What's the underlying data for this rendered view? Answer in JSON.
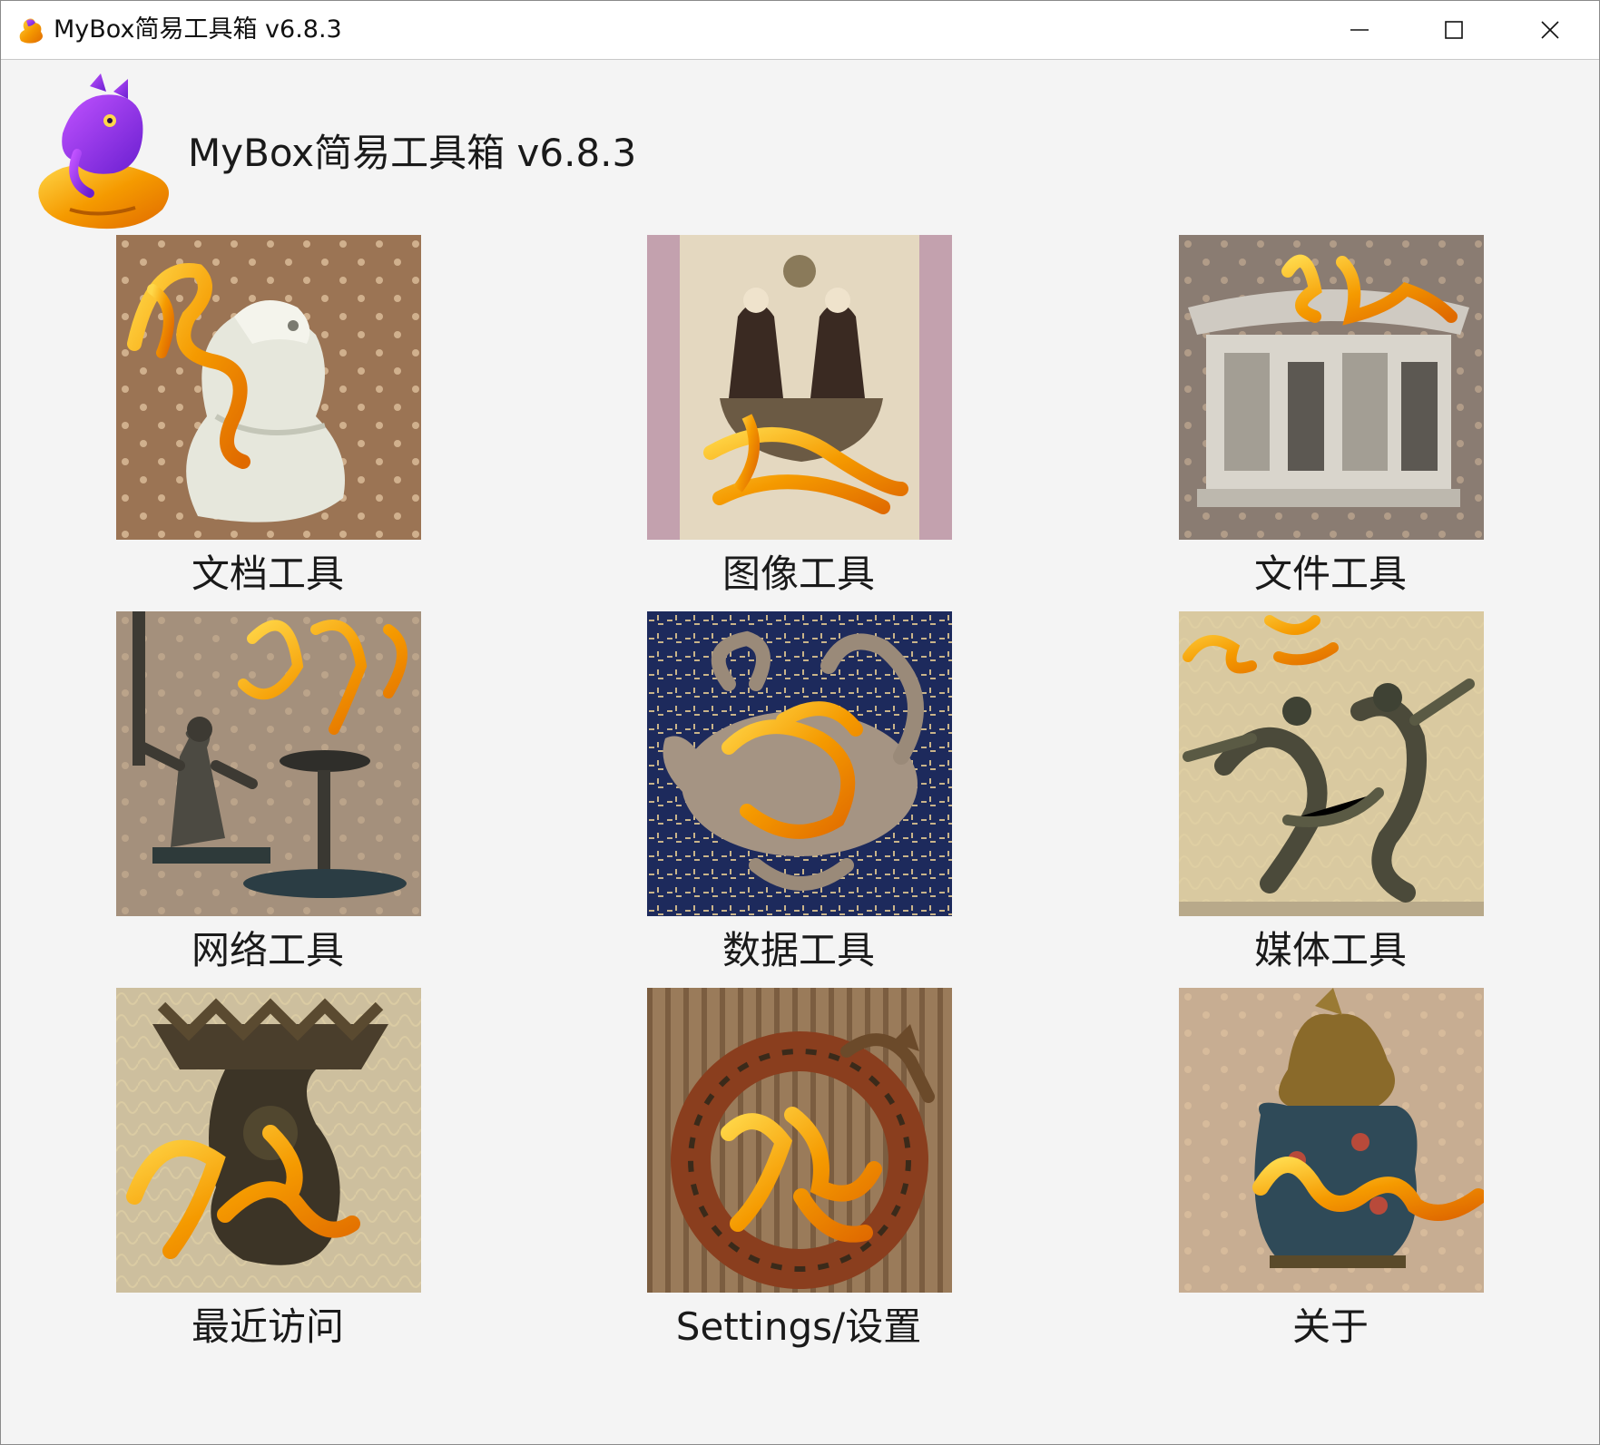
{
  "window": {
    "title": "MyBox简易工具箱 v6.8.3",
    "buttons": {
      "minimize": "minimize-icon",
      "maximize": "maximize-icon",
      "close": "close-icon"
    }
  },
  "header": {
    "title": "MyBox简易工具箱 v6.8.3",
    "logo_icon": "dragon-logo-icon"
  },
  "colors": {
    "background": "#f4f4f4",
    "titlebar": "#ffffff",
    "accent_purple": "#8a2be2",
    "accent_gold": "#f2a900"
  },
  "tiles": [
    {
      "label": "文档工具",
      "icon": "jade-bird-icon"
    },
    {
      "label": "图像工具",
      "icon": "silk-painting-icon"
    },
    {
      "label": "文件工具",
      "icon": "porcelain-house-icon"
    },
    {
      "label": "网络工具",
      "icon": "bronze-lamp-figure-icon"
    },
    {
      "label": "数据工具",
      "icon": "tortoise-snake-icon"
    },
    {
      "label": "媒体工具",
      "icon": "bronze-dancers-icon"
    },
    {
      "label": "最近访问",
      "icon": "bronze-censer-icon"
    },
    {
      "label": "Settings/设置",
      "icon": "coiled-dragon-icon"
    },
    {
      "label": "关于",
      "icon": "cloisonne-beast-icon"
    }
  ]
}
